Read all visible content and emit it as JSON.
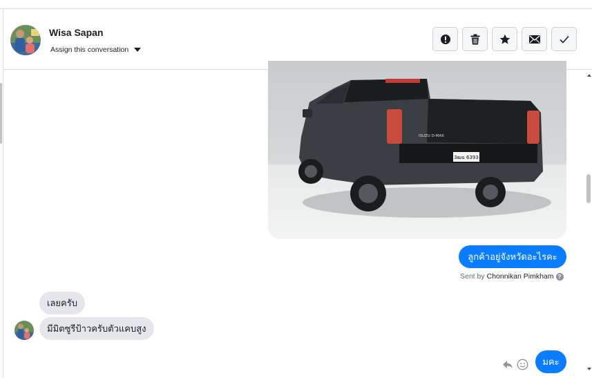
{
  "header": {
    "name": "Wisa Sapan",
    "assign_label": "Assign this conversation",
    "actions": [
      "alert-icon",
      "trash-icon",
      "star-icon",
      "envelope-icon",
      "check-icon"
    ]
  },
  "messages": {
    "outgoing_1": "ลูกค้าอยู่จังหวัดอะไรคะ",
    "sent_by_prefix": "Sent by",
    "sent_by_name": "Chonnikan Pimkham",
    "incoming_1": "เลยครับ",
    "incoming_2": "มีมิตซูรีป้าวครับตัวแคบสูง",
    "outgoing_2": "มคะ"
  },
  "photo": {
    "plate_text": "3ฒฉ 6393",
    "badge_text": "ISUZU D-MAX"
  },
  "colors": {
    "accent": "#0a7cff",
    "incoming_bubble": "#e4e6eb",
    "border": "#dadde1"
  }
}
